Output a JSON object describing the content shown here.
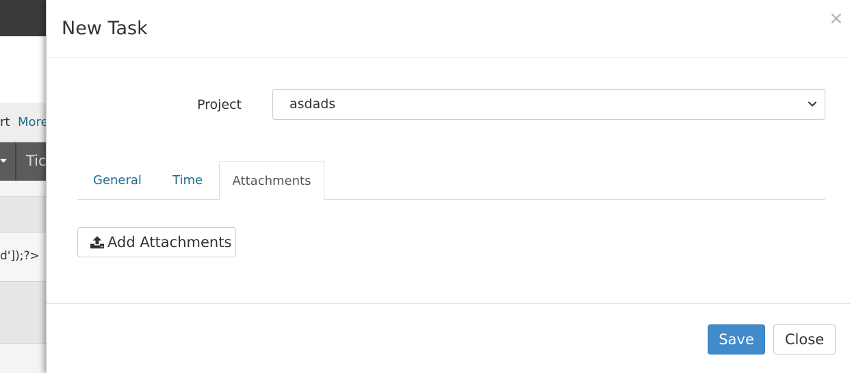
{
  "background": {
    "links": {
      "partial_left": "rt",
      "more": "More"
    },
    "table_header_partial": "Tic",
    "code_fragment": "d']);?>"
  },
  "modal": {
    "title": "New Task",
    "close_symbol": "×",
    "project": {
      "label": "Project",
      "selected": "asdads"
    },
    "tabs": [
      {
        "label": "General",
        "active": false
      },
      {
        "label": "Time",
        "active": false
      },
      {
        "label": "Attachments",
        "active": true
      }
    ],
    "add_attachments_label": "Add Attachments",
    "footer": {
      "save_label": "Save",
      "close_label": "Close"
    }
  },
  "colors": {
    "primary_button": "#428bca",
    "link": "#1f6b8e",
    "topbar": "#3a3a3a"
  },
  "icons": {
    "upload": "upload-icon",
    "chevron": "chevron-down-icon",
    "close": "close-icon"
  }
}
